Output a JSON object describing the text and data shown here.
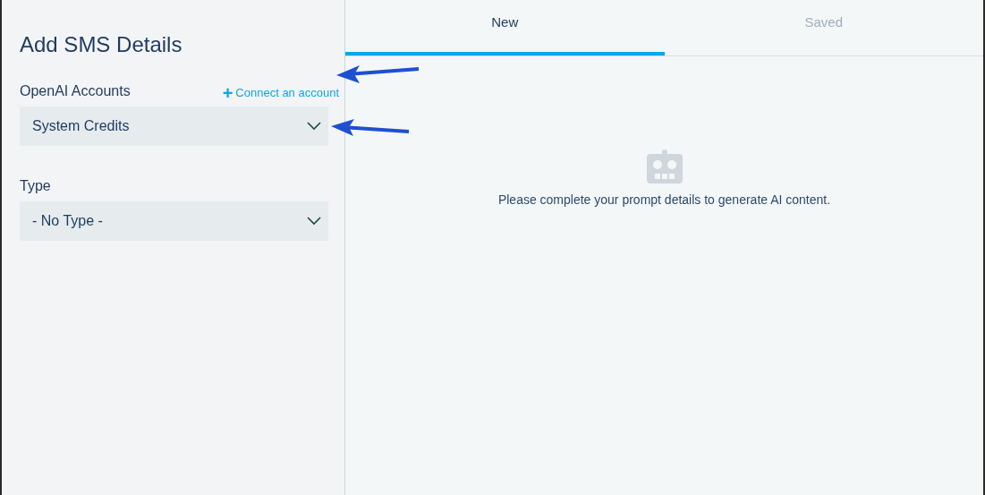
{
  "panel": {
    "title": "Add SMS Details",
    "fields": [
      {
        "label": "OpenAI Accounts",
        "link": {
          "icon": "+",
          "text": "Connect an account"
        },
        "value": "System Credits"
      },
      {
        "label": "Type",
        "value": "- No Type -"
      }
    ]
  },
  "tabs": [
    {
      "label": "New",
      "selected": true
    },
    {
      "label": "Saved",
      "selected": false
    }
  ],
  "empty_state": {
    "message": "Please complete your prompt details to generate AI content."
  }
}
